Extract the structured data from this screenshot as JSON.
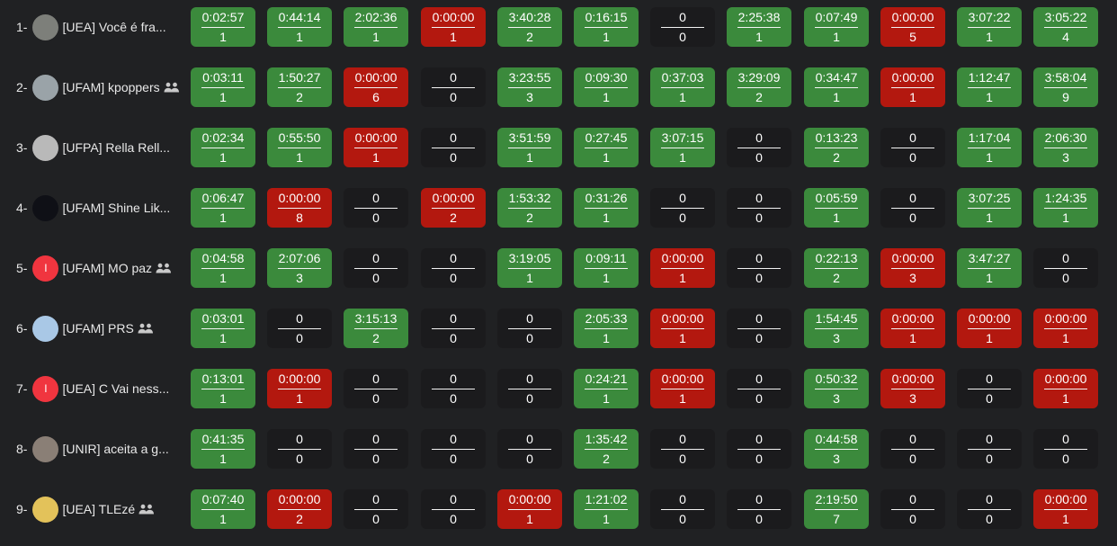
{
  "rows": [
    {
      "rank": "1",
      "name": "[UEA] Você é fra...",
      "group": false,
      "avatar": {
        "kind": "photo",
        "color": "#7d7f7a"
      },
      "cells": [
        [
          "0:02:57",
          "1",
          "ac"
        ],
        [
          "0:44:14",
          "1",
          "ac"
        ],
        [
          "2:02:36",
          "1",
          "ac"
        ],
        [
          "0:00:00",
          "1",
          "wa"
        ],
        [
          "3:40:28",
          "2",
          "ac"
        ],
        [
          "0:16:15",
          "1",
          "ac"
        ],
        [
          "0",
          "0",
          "na"
        ],
        [
          "2:25:38",
          "1",
          "ac"
        ],
        [
          "0:07:49",
          "1",
          "ac"
        ],
        [
          "0:00:00",
          "5",
          "wa"
        ],
        [
          "3:07:22",
          "1",
          "ac"
        ],
        [
          "3:05:22",
          "4",
          "ac"
        ]
      ]
    },
    {
      "rank": "2",
      "name": "[UFAM] kpoppers",
      "group": true,
      "avatar": {
        "kind": "photo",
        "color": "#9aa3a8"
      },
      "cells": [
        [
          "0:03:11",
          "1",
          "ac"
        ],
        [
          "1:50:27",
          "2",
          "ac"
        ],
        [
          "0:00:00",
          "6",
          "wa"
        ],
        [
          "0",
          "0",
          "na"
        ],
        [
          "3:23:55",
          "3",
          "ac"
        ],
        [
          "0:09:30",
          "1",
          "ac"
        ],
        [
          "0:37:03",
          "1",
          "ac"
        ],
        [
          "3:29:09",
          "2",
          "ac"
        ],
        [
          "0:34:47",
          "1",
          "ac"
        ],
        [
          "0:00:00",
          "1",
          "wa"
        ],
        [
          "1:12:47",
          "1",
          "ac"
        ],
        [
          "3:58:04",
          "9",
          "ac"
        ]
      ]
    },
    {
      "rank": "3",
      "name": "[UFPA] Rella Rell...",
      "group": false,
      "avatar": {
        "kind": "photo",
        "color": "#b9b9b9"
      },
      "cells": [
        [
          "0:02:34",
          "1",
          "ac"
        ],
        [
          "0:55:50",
          "1",
          "ac"
        ],
        [
          "0:00:00",
          "1",
          "wa"
        ],
        [
          "0",
          "0",
          "na"
        ],
        [
          "3:51:59",
          "1",
          "ac"
        ],
        [
          "0:27:45",
          "1",
          "ac"
        ],
        [
          "3:07:15",
          "1",
          "ac"
        ],
        [
          "0",
          "0",
          "na"
        ],
        [
          "0:13:23",
          "2",
          "ac"
        ],
        [
          "0",
          "0",
          "na"
        ],
        [
          "1:17:04",
          "1",
          "ac"
        ],
        [
          "2:06:30",
          "3",
          "ac"
        ]
      ]
    },
    {
      "rank": "4",
      "name": "[UFAM] Shine Lik...",
      "group": false,
      "avatar": {
        "kind": "photo",
        "color": "#0f1016"
      },
      "cells": [
        [
          "0:06:47",
          "1",
          "ac"
        ],
        [
          "0:00:00",
          "8",
          "wa"
        ],
        [
          "0",
          "0",
          "na"
        ],
        [
          "0:00:00",
          "2",
          "wa"
        ],
        [
          "1:53:32",
          "2",
          "ac"
        ],
        [
          "0:31:26",
          "1",
          "ac"
        ],
        [
          "0",
          "0",
          "na"
        ],
        [
          "0",
          "0",
          "na"
        ],
        [
          "0:05:59",
          "1",
          "ac"
        ],
        [
          "0",
          "0",
          "na"
        ],
        [
          "3:07:25",
          "1",
          "ac"
        ],
        [
          "1:24:35",
          "1",
          "ac"
        ]
      ]
    },
    {
      "rank": "5",
      "name": "[UFAM] MO paz",
      "group": true,
      "avatar": {
        "kind": "letter",
        "letter": "I",
        "color": "#f0353f"
      },
      "cells": [
        [
          "0:04:58",
          "1",
          "ac"
        ],
        [
          "2:07:06",
          "3",
          "ac"
        ],
        [
          "0",
          "0",
          "na"
        ],
        [
          "0",
          "0",
          "na"
        ],
        [
          "3:19:05",
          "1",
          "ac"
        ],
        [
          "0:09:11",
          "1",
          "ac"
        ],
        [
          "0:00:00",
          "1",
          "wa"
        ],
        [
          "0",
          "0",
          "na"
        ],
        [
          "0:22:13",
          "2",
          "ac"
        ],
        [
          "0:00:00",
          "3",
          "wa"
        ],
        [
          "3:47:27",
          "1",
          "ac"
        ],
        [
          "0",
          "0",
          "na"
        ]
      ]
    },
    {
      "rank": "6",
      "name": "[UFAM] PRS",
      "group": true,
      "avatar": {
        "kind": "photo",
        "color": "#a9c8e6"
      },
      "cells": [
        [
          "0:03:01",
          "1",
          "ac"
        ],
        [
          "0",
          "0",
          "na"
        ],
        [
          "3:15:13",
          "2",
          "ac"
        ],
        [
          "0",
          "0",
          "na"
        ],
        [
          "0",
          "0",
          "na"
        ],
        [
          "2:05:33",
          "1",
          "ac"
        ],
        [
          "0:00:00",
          "1",
          "wa"
        ],
        [
          "0",
          "0",
          "na"
        ],
        [
          "1:54:45",
          "3",
          "ac"
        ],
        [
          "0:00:00",
          "1",
          "wa"
        ],
        [
          "0:00:00",
          "1",
          "wa"
        ],
        [
          "0:00:00",
          "1",
          "wa"
        ]
      ]
    },
    {
      "rank": "7",
      "name": "[UEA] C Vai ness...",
      "group": false,
      "avatar": {
        "kind": "letter",
        "letter": "I",
        "color": "#f0353f"
      },
      "cells": [
        [
          "0:13:01",
          "1",
          "ac"
        ],
        [
          "0:00:00",
          "1",
          "wa"
        ],
        [
          "0",
          "0",
          "na"
        ],
        [
          "0",
          "0",
          "na"
        ],
        [
          "0",
          "0",
          "na"
        ],
        [
          "0:24:21",
          "1",
          "ac"
        ],
        [
          "0:00:00",
          "1",
          "wa"
        ],
        [
          "0",
          "0",
          "na"
        ],
        [
          "0:50:32",
          "3",
          "ac"
        ],
        [
          "0:00:00",
          "3",
          "wa"
        ],
        [
          "0",
          "0",
          "na"
        ],
        [
          "0:00:00",
          "1",
          "wa"
        ]
      ]
    },
    {
      "rank": "8",
      "name": "[UNIR] aceita a g...",
      "group": false,
      "avatar": {
        "kind": "photo",
        "color": "#8a7f76"
      },
      "cells": [
        [
          "0:41:35",
          "1",
          "ac"
        ],
        [
          "0",
          "0",
          "na"
        ],
        [
          "0",
          "0",
          "na"
        ],
        [
          "0",
          "0",
          "na"
        ],
        [
          "0",
          "0",
          "na"
        ],
        [
          "1:35:42",
          "2",
          "ac"
        ],
        [
          "0",
          "0",
          "na"
        ],
        [
          "0",
          "0",
          "na"
        ],
        [
          "0:44:58",
          "3",
          "ac"
        ],
        [
          "0",
          "0",
          "na"
        ],
        [
          "0",
          "0",
          "na"
        ],
        [
          "0",
          "0",
          "na"
        ]
      ]
    },
    {
      "rank": "9",
      "name": "[UEA] TLEzé",
      "group": true,
      "avatar": {
        "kind": "photo",
        "color": "#e3c25a"
      },
      "cells": [
        [
          "0:07:40",
          "1",
          "ac"
        ],
        [
          "0:00:00",
          "2",
          "wa"
        ],
        [
          "0",
          "0",
          "na"
        ],
        [
          "0",
          "0",
          "na"
        ],
        [
          "0:00:00",
          "1",
          "wa"
        ],
        [
          "1:21:02",
          "1",
          "ac"
        ],
        [
          "0",
          "0",
          "na"
        ],
        [
          "0",
          "0",
          "na"
        ],
        [
          "2:19:50",
          "7",
          "ac"
        ],
        [
          "0",
          "0",
          "na"
        ],
        [
          "0",
          "0",
          "na"
        ],
        [
          "0:00:00",
          "1",
          "wa"
        ]
      ]
    }
  ],
  "rank_suffix": " - ",
  "colors": {
    "accepted": "#3b8a3c",
    "wrong": "#b3180f",
    "untried": "#1b1b1d",
    "background": "#202123"
  },
  "icons": {
    "group": "group-icon"
  }
}
